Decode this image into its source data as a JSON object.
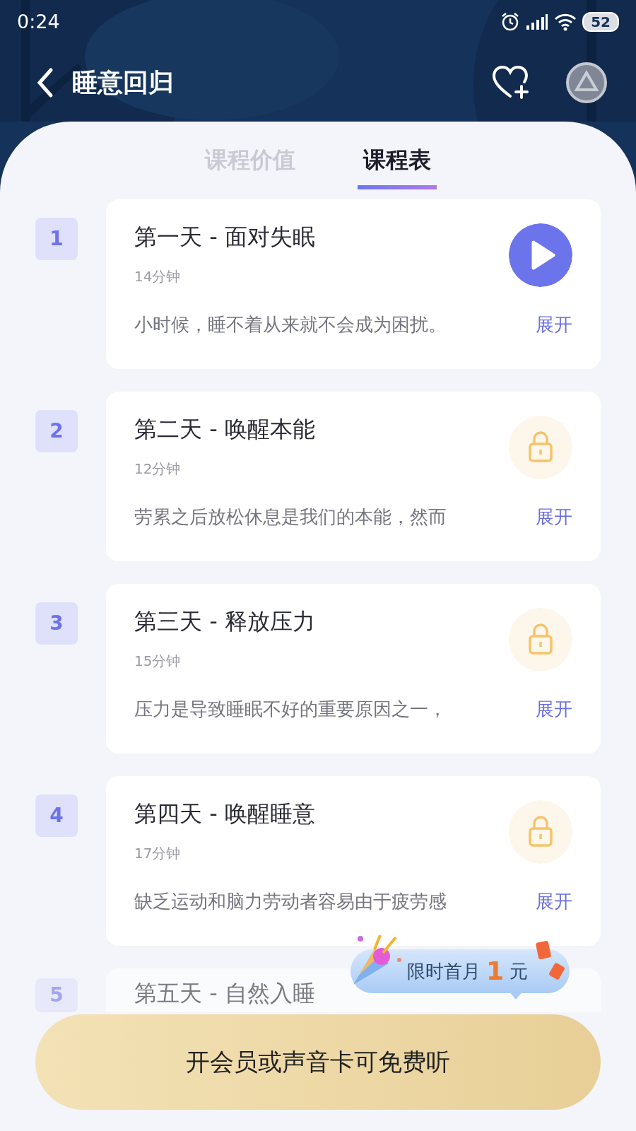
{
  "status_bar": {
    "time": "0:24",
    "battery": "52"
  },
  "header": {
    "title": "睡意回归"
  },
  "tabs": [
    {
      "label": "课程价值",
      "selected": false
    },
    {
      "label": "课程表",
      "selected": true
    }
  ],
  "lessons": [
    {
      "number": "1",
      "title": "第一天 - 面对失眠",
      "duration": "14分钟",
      "summary": "小时候，睡不着从来就不会成为困扰。",
      "expand": "展开",
      "locked": false
    },
    {
      "number": "2",
      "title": "第二天 - 唤醒本能",
      "duration": "12分钟",
      "summary": "劳累之后放松休息是我们的本能，然而",
      "expand": "展开",
      "locked": true
    },
    {
      "number": "3",
      "title": "第三天 - 释放压力",
      "duration": "15分钟",
      "summary": "压力是导致睡眠不好的重要原因之一，",
      "expand": "展开",
      "locked": true
    },
    {
      "number": "4",
      "title": "第四天 - 唤醒睡意",
      "duration": "17分钟",
      "summary": "缺乏运动和脑力劳动者容易由于疲劳感",
      "expand": "展开",
      "locked": true
    },
    {
      "number": "5",
      "title": "第五天 - 自然入睡"
    }
  ],
  "promo": {
    "text": "限时首月",
    "amount": "1",
    "unit": "元"
  },
  "cta_button": "开会员或声音卡可免费听"
}
